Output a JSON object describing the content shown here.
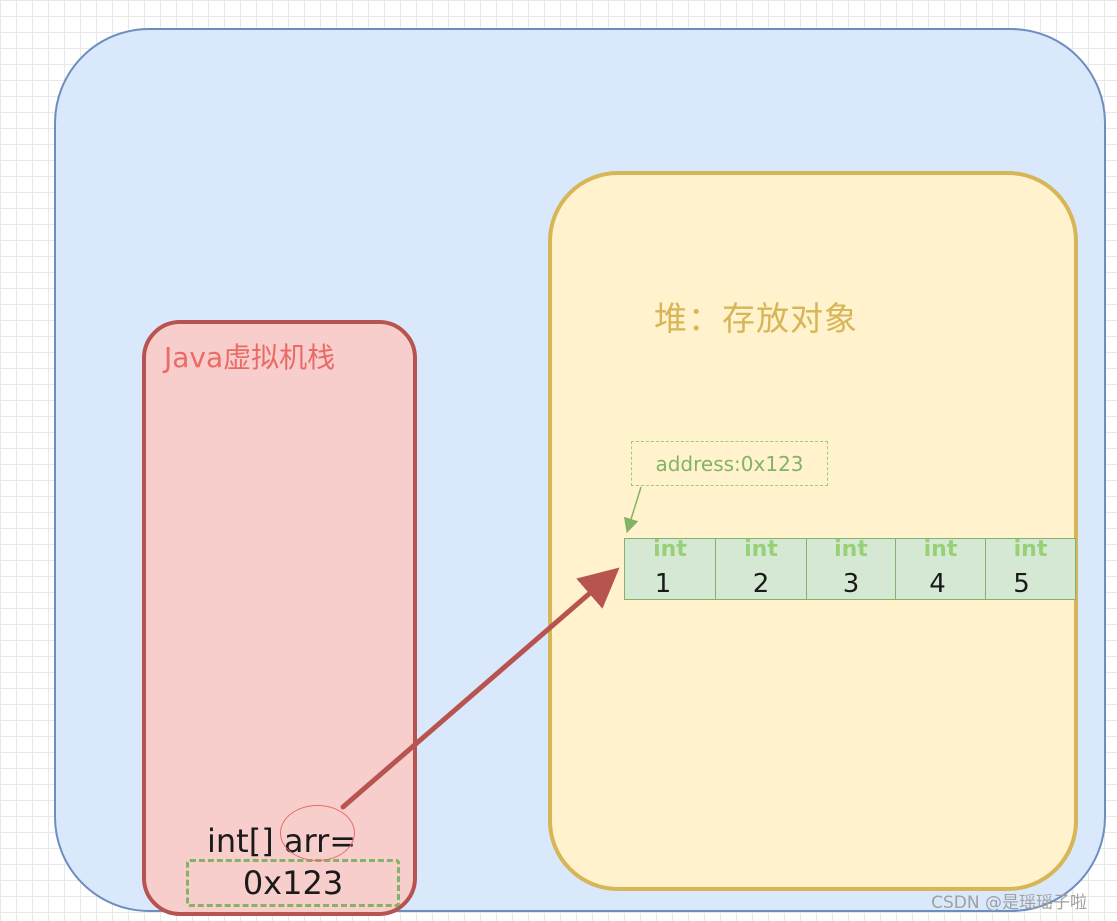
{
  "heap": {
    "title": "堆：存放对象",
    "address_label": "address:0x123",
    "array_cells": [
      {
        "type": "int",
        "value": "1"
      },
      {
        "type": "int",
        "value": "2"
      },
      {
        "type": "int",
        "value": "3"
      },
      {
        "type": "int",
        "value": "4"
      },
      {
        "type": "int",
        "value": "5"
      }
    ]
  },
  "stack": {
    "title": "Java虚拟机栈",
    "variable_declaration": "int[] arr=",
    "variable_value": "0x123"
  },
  "watermark": "CSDN @是瑶瑶子啦",
  "colors": {
    "outer_fill": "#dae8fc",
    "outer_stroke": "#6c8ebf",
    "heap_fill": "#fff2cc",
    "heap_stroke": "#d6b656",
    "stack_fill": "#f8cecc",
    "stack_stroke": "#b85450",
    "array_fill": "#d5e8d4",
    "array_stroke": "#82b366",
    "pointer_arrow": "#b85450"
  }
}
